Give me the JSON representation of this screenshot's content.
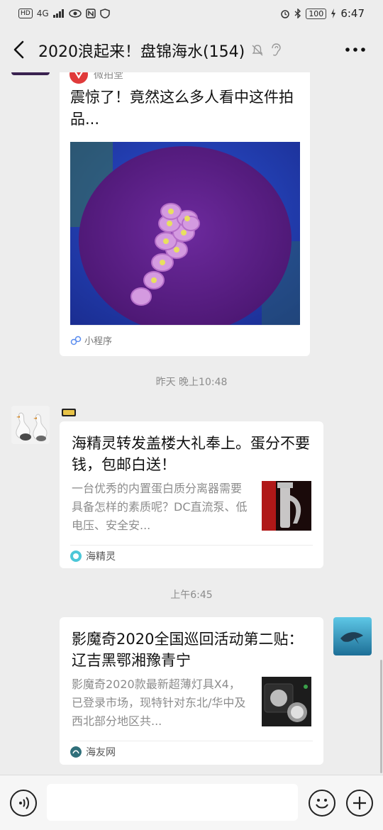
{
  "status_bar": {
    "left_labels": [
      "HD",
      "4G"
    ],
    "time": "6:47",
    "battery": "100"
  },
  "nav": {
    "title": "2020浪起来！盘锦海水(154)"
  },
  "messages": {
    "mini_program_card": {
      "source": "微拍堂",
      "title": "震惊了！竟然这么多人看中这件拍品...",
      "footer_label": "小程序"
    },
    "timestamp_1": "昨天 晚上10:48",
    "link_card_1": {
      "title": "海精灵转发盖楼大礼奉上。蛋分不要钱，包邮白送！",
      "description": "一台优秀的内置蛋白质分离器需要具备怎样的素质呢？DC直流泵、低电压、安全安...",
      "source": "海精灵"
    },
    "timestamp_2": "上午6:45",
    "link_card_2": {
      "title": "影魔奇2020全国巡回活动第二贴： 辽吉黑鄂湘豫青宁",
      "description": "影魔奇2020款最新超薄灯具X4，已登录市场，现特针对东北/华中及西北部分地区共...",
      "source": "海友网"
    }
  },
  "colors": {
    "background": "#ededed",
    "card": "#ffffff",
    "muted_text": "#8c8c8c",
    "coral_purple": "#5b1e8a"
  },
  "icons": [
    "back-icon",
    "mute-icon",
    "ear-icon",
    "more-icon",
    "mini-program-icon",
    "voice-icon",
    "emoji-icon",
    "plus-icon"
  ]
}
